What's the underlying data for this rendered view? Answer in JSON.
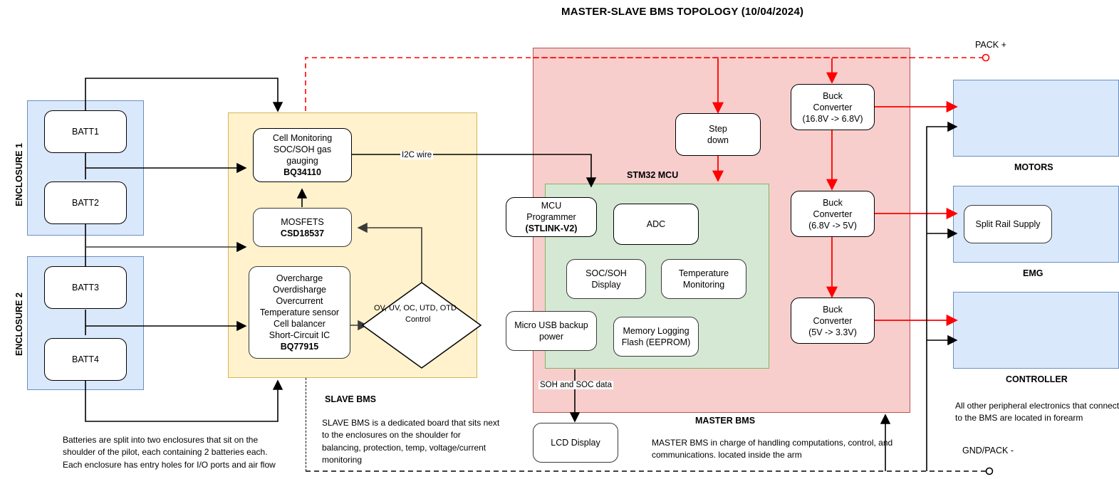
{
  "title": "MASTER-SLAVE BMS TOPOLOGY (10/04/2024)",
  "colors": {
    "master_region": "#f8cecc",
    "master_border": "#b85450",
    "slave_region": "#fff2cc",
    "slave_border": "#d6b656",
    "mcu_region": "#d5e8d4",
    "mcu_border": "#82b366",
    "enclosure_region": "#dae8fc",
    "enclosure_border": "#6c8ebf",
    "power_wire": "#ff0000",
    "signal_wire": "#000000"
  },
  "enclosures": {
    "label_1": "ENCLOSURE 1",
    "label_2": "ENCLOSURE 2",
    "batteries": [
      "BATT1",
      "BATT2",
      "BATT3",
      "BATT4"
    ],
    "note": "Batteries are split into two enclosures that sit on the shoulder of the pilot,  each containing 2 batteries each. Each enclosure has entry holes for I/O ports and air flow"
  },
  "slave_bms": {
    "region_title": "SLAVE BMS",
    "description": "SLAVE BMS is a dedicated board that sits next to the enclosures on the shoulder for balancing, protection, temp, voltage/current monitoring",
    "cell_monitoring": {
      "line1": "Cell Monitoring",
      "line2": "SOC/SOH gas gauging",
      "part": "BQ34110"
    },
    "mosfets": {
      "line1": "MOSFETS",
      "part": "CSD18537"
    },
    "protection": {
      "lines": [
        "Overcharge",
        "Overdisharge",
        "Overcurrent",
        "Temperature sensor",
        "Cell balancer",
        "Short-Circuit IC"
      ],
      "part": "BQ77915"
    },
    "decision": {
      "line1": "OV, UV, OC, UTD, OTD",
      "line2": "Control"
    },
    "i2c_label": "I2C wire"
  },
  "master_bms": {
    "region_title": "MASTER BMS",
    "description": "MASTER BMS in charge of handling computations, control, and communications. located inside the arm",
    "mcu_title": "STM32 MCU",
    "step_down": {
      "line1": "Step",
      "line2": "down"
    },
    "mcu_blocks": [
      {
        "id": "mcu-programmer",
        "line1": "MCU",
        "line2": "Programmer",
        "line3": "(STLINK-V2)"
      },
      {
        "id": "adc",
        "line1": "ADC"
      },
      {
        "id": "soc-soh-display",
        "line1": "SOC/SOH",
        "line2": "Display"
      },
      {
        "id": "temperature-monitoring",
        "line1": "Temperature",
        "line2": "Monitoring"
      },
      {
        "id": "micro-usb-backup-power",
        "line1": "Micro USB backup",
        "line2": "power"
      },
      {
        "id": "memory-logging-flash",
        "line1": "Memory Logging",
        "line2": "Flash (EEPROM)"
      }
    ],
    "lcd_display": "LCD Display",
    "soh_soc_label": "SOH and SOC data",
    "buck_converters": [
      {
        "line1": "Buck",
        "line2": "Converter",
        "line3": "(16.8V -> 6.8V)"
      },
      {
        "line1": "Buck",
        "line2": "Converter",
        "line3": "(6.8V -> 5V)"
      },
      {
        "line1": "Buck",
        "line2": "Converter",
        "line3": "(5V -> 3.3V)"
      }
    ]
  },
  "peripherals": {
    "motors_label": "MOTORS",
    "emg_label": "EMG",
    "controller_label": "CONTROLLER",
    "split_rail_supply": "Split Rail Supply",
    "note": "All other peripheral electronics that connect to the BMS are located in forearm"
  },
  "rails": {
    "pack_plus": "PACK +",
    "gnd_pack_minus": "GND/PACK -"
  }
}
